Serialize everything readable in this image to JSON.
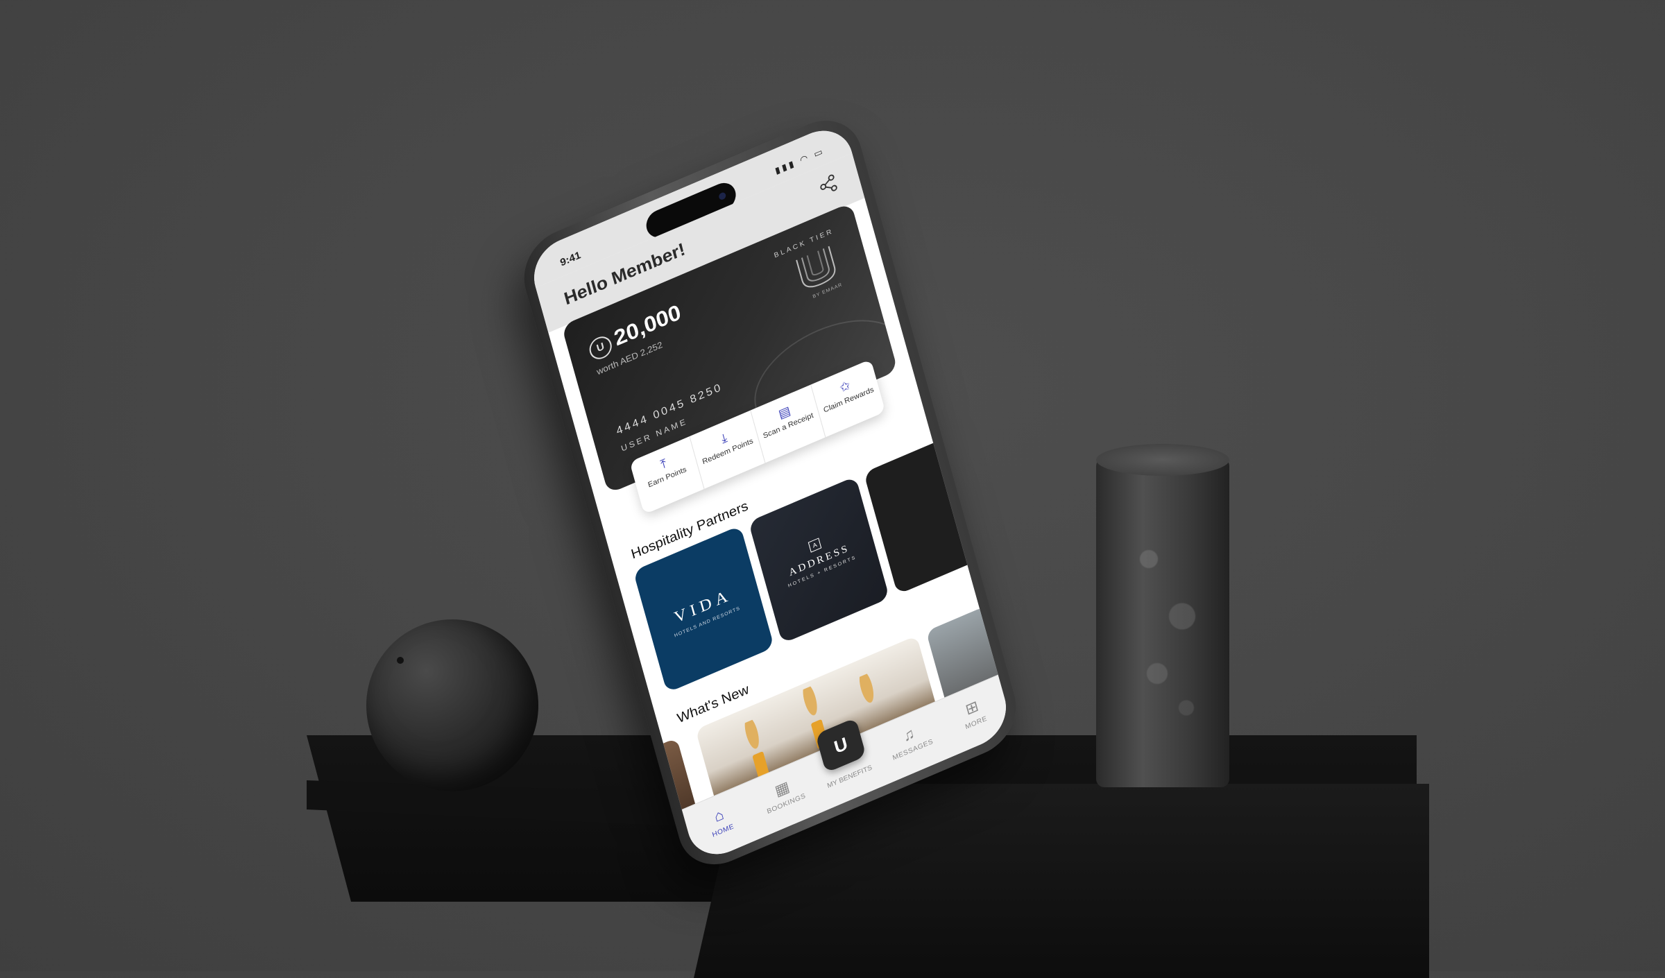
{
  "status_bar": {
    "time": "9:41",
    "icons": "▮▮▮ ◠ ▭"
  },
  "header": {
    "greeting": "Hello Member!",
    "share_icon": "share-icon"
  },
  "card": {
    "points": "20,000",
    "worth": "worth AED 2,252",
    "tier": "BLACK TIER",
    "by": "BY EMAAR",
    "number": "4444 0045 8250",
    "holder": "USER NAME",
    "coin_glyph": "U"
  },
  "actions": [
    {
      "label": "Earn Points",
      "icon": "earn-icon"
    },
    {
      "label": "Redeem Points",
      "icon": "redeem-icon"
    },
    {
      "label": "Scan a Receipt",
      "icon": "scan-receipt-icon"
    },
    {
      "label": "Claim Rewards",
      "icon": "claim-rewards-icon"
    }
  ],
  "sections": {
    "partners": "Hospitality Partners",
    "news": "What's New"
  },
  "partners": [
    {
      "name": "VIDA",
      "sub": "HOTELS AND RESORTS"
    },
    {
      "name": "ADDRESS",
      "sub": "HOTELS + RESORTS",
      "mark": "A"
    }
  ],
  "tabbar": [
    {
      "label": "HOME",
      "icon": "home-icon",
      "active": true
    },
    {
      "label": "BOOKINGS",
      "icon": "calendar-icon"
    },
    {
      "label": "MY BENEFITS",
      "icon": "benefits-icon",
      "glyph": "U"
    },
    {
      "label": "MESSAGES",
      "icon": "bell-icon"
    },
    {
      "label": "MORE",
      "icon": "grid-icon"
    }
  ],
  "colors": {
    "accent": "#3a3fb8",
    "vida": "#0b3c64",
    "address": "#252a34",
    "card": "#2a2a2a"
  }
}
